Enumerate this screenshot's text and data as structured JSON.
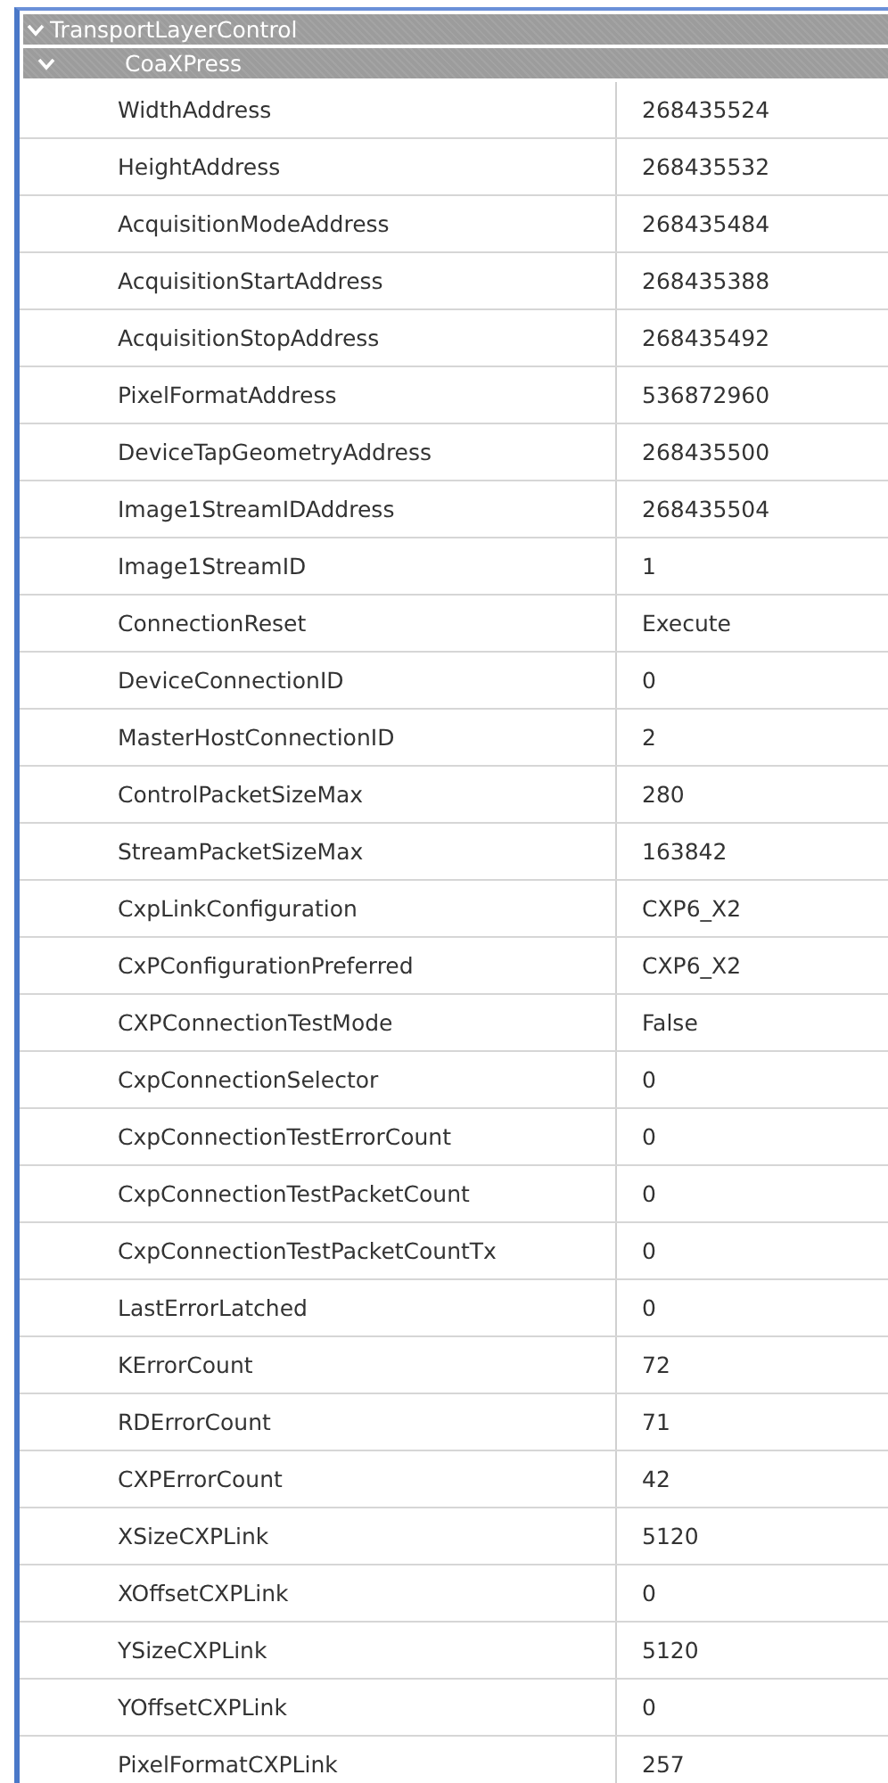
{
  "tree": {
    "title": "TransportLayerControl",
    "expanded": true,
    "children": [
      {
        "title": "CoaXPress",
        "expanded": true,
        "rows": [
          {
            "name": "WidthAddress",
            "value": "268435524"
          },
          {
            "name": "HeightAddress",
            "value": "268435532"
          },
          {
            "name": "AcquisitionModeAddress",
            "value": "268435484"
          },
          {
            "name": "AcquisitionStartAddress",
            "value": "268435388"
          },
          {
            "name": "AcquisitionStopAddress",
            "value": "268435492"
          },
          {
            "name": "PixelFormatAddress",
            "value": "536872960"
          },
          {
            "name": "DeviceTapGeometryAddress",
            "value": "268435500"
          },
          {
            "name": "Image1StreamIDAddress",
            "value": "268435504"
          },
          {
            "name": "Image1StreamID",
            "value": "1"
          },
          {
            "name": "ConnectionReset",
            "value": "Execute"
          },
          {
            "name": "DeviceConnectionID",
            "value": "0"
          },
          {
            "name": "MasterHostConnectionID",
            "value": "2"
          },
          {
            "name": "ControlPacketSizeMax",
            "value": "280"
          },
          {
            "name": "StreamPacketSizeMax",
            "value": "163842"
          },
          {
            "name": "CxpLinkConfiguration",
            "value": "CXP6_X2"
          },
          {
            "name": "CxPConfigurationPreferred",
            "value": "CXP6_X2"
          },
          {
            "name": "CXPConnectionTestMode",
            "value": "False"
          },
          {
            "name": "CxpConnectionSelector",
            "value": "0"
          },
          {
            "name": "CxpConnectionTestErrorCount",
            "value": "0"
          },
          {
            "name": "CxpConnectionTestPacketCount",
            "value": "0"
          },
          {
            "name": "CxpConnectionTestPacketCountTx",
            "value": "0"
          },
          {
            "name": "LastErrorLatched",
            "value": "0"
          },
          {
            "name": "KErrorCount",
            "value": "72"
          },
          {
            "name": "RDErrorCount",
            "value": "71"
          },
          {
            "name": "CXPErrorCount",
            "value": "42"
          },
          {
            "name": "XSizeCXPLink",
            "value": "5120"
          },
          {
            "name": "XOffsetCXPLink",
            "value": "0"
          },
          {
            "name": "YSizeCXPLink",
            "value": "5120"
          },
          {
            "name": "YOffsetCXPLink",
            "value": "0"
          },
          {
            "name": "PixelFormatCXPLink",
            "value": "257"
          }
        ]
      }
    ]
  }
}
